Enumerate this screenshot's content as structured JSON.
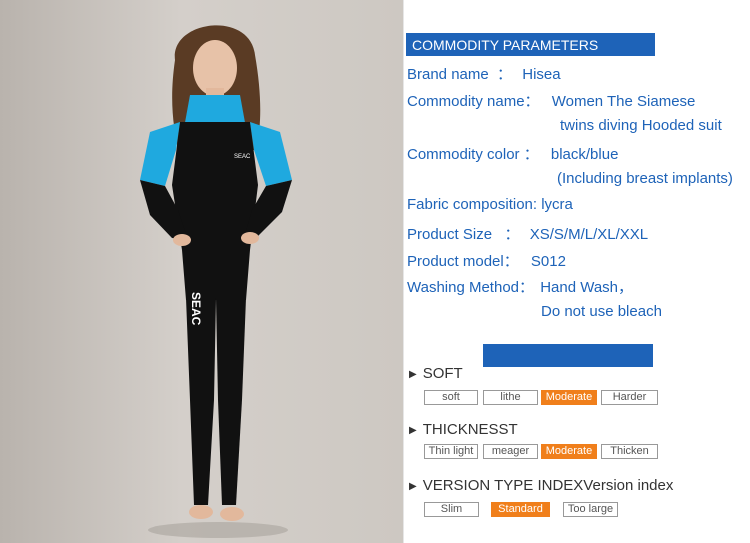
{
  "header": {
    "title": "COMMODITY PARAMETERS"
  },
  "params": {
    "brand_label": "Brand name  ：",
    "brand_value": "Hisea",
    "name_label": "Commodity name：",
    "name_value_1": "Women  The Siamese",
    "name_value_2": "twins diving  Hooded  suit",
    "color_label": "Commodity color ：",
    "color_value_1": "black/blue",
    "color_value_2": "(Including breast implants)",
    "fabric": "Fabric composition: lycra",
    "size_label": "Product Size   ：",
    "size_value": "XS/S/M/L/XL/XXL",
    "model_label": "Product model：",
    "model_value": "S012",
    "wash_label": "Washing Method：",
    "wash_value_1": "Hand Wash，",
    "wash_value_2": "Do not use bleach"
  },
  "soft": {
    "title": "SOFT",
    "options": [
      "soft",
      "lithe",
      "Moderate",
      "Harder"
    ],
    "selected": "Moderate"
  },
  "thickness": {
    "title": "THICKNESST",
    "options": [
      "Thin light",
      "meager",
      "Moderate",
      "Thicken"
    ],
    "selected": "Moderate"
  },
  "version": {
    "title": "VERSION TYPE INDEXVersion index",
    "options": [
      "Slim",
      "Standard",
      "Too large"
    ],
    "selected": "Standard"
  },
  "suit": {
    "logo_chest": "SEAC",
    "logo_leg": "SEAC"
  },
  "colors": {
    "brand_blue": "#1e63b8",
    "accent_orange": "#f07f1b",
    "suit_cyan": "#1fa9df"
  }
}
